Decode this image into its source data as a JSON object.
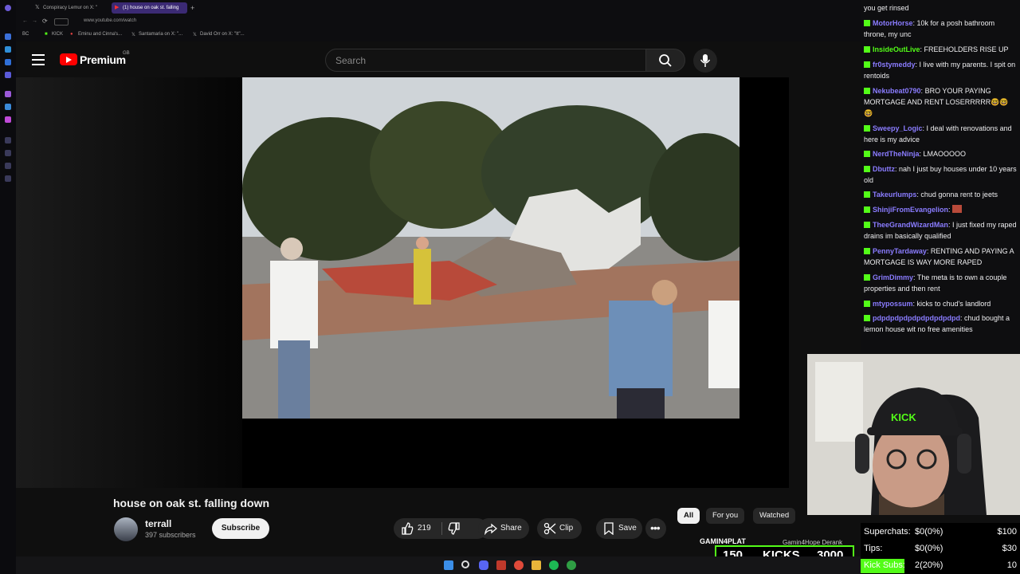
{
  "browser": {
    "tabs": [
      {
        "label": "Conspiracy Lemur on X: \"",
        "icon": "x-logo"
      },
      {
        "label": "(1) house on oak st. falling",
        "icon": "youtube-logo"
      }
    ],
    "new_tab": "+",
    "url": "www.youtube.com/watch",
    "bookmarks": [
      "BC",
      "KICK",
      "Eminu and Cinna's...",
      "Santamaria on X: \"...",
      "David Orr on X: \"It\"..."
    ]
  },
  "youtube": {
    "logo_text": "Premium",
    "region": "GB",
    "search": {
      "placeholder": "Search",
      "value": ""
    },
    "video": {
      "title": "house on oak st. falling down",
      "channel": "terrall",
      "subscribers": "397 subscribers",
      "subscribe_label": "Subscribe",
      "likes": "219",
      "share_label": "Share",
      "clip_label": "Clip",
      "save_label": "Save"
    },
    "chips": [
      "All",
      "For you",
      "Watched"
    ],
    "chips_active": "All"
  },
  "chat": {
    "top_fragment": "you get rinsed",
    "messages": [
      {
        "user": "MotorHorse",
        "text": "10k for a posh bathroom throne, my unc",
        "color": "#8a7cff"
      },
      {
        "user": "InsideOutLive",
        "text": "FREEHOLDERS RISE UP",
        "color": "#53fc18"
      },
      {
        "user": "fr0stymeddy",
        "text": "I live with my parents. I spit on rentoids",
        "color": "#8a7cff"
      },
      {
        "user": "Nekubeat0790",
        "text": "BRO YOUR PAYING MORTGAGE AND RENT LOSERRRRR🤓🤓🤓",
        "color": "#8a7cff"
      },
      {
        "user": "Sweepy_Logic",
        "text": "I deal with renovations and here is my advice",
        "color": "#8a7cff"
      },
      {
        "user": "NerdTheNinja",
        "text": "LMAOOOOO",
        "color": "#8a7cff"
      },
      {
        "user": "Dbuttz",
        "text": "nah I just buy houses under 10 years old",
        "color": "#8a7cff"
      },
      {
        "user": "Takeurlumps",
        "text": "chud gonna rent to jeets",
        "color": "#8a7cff"
      },
      {
        "user": "ShinjiFromEvangelion",
        "text": "",
        "color": "#8a7cff"
      },
      {
        "user": "TheeGrandWizardMan",
        "text": "I just fixed my raped drains im basically qualified",
        "color": "#8a7cff"
      },
      {
        "user": "PennyTardaway",
        "text": "RENTING AND PAYING A MORTGAGE IS WAY MORE RAPED",
        "color": "#8a7cff"
      },
      {
        "user": "GrimDimmy",
        "text": "The meta is to own a couple properties and then rent",
        "color": "#8a7cff"
      },
      {
        "user": "mtypossum",
        "text": "kicks to chud's landlord",
        "color": "#8a7cff"
      },
      {
        "user": "pdpdpdpdpdpdpdpdpdpd",
        "text": "chud bought a lemon house wit no free amenities",
        "color": "#8a7cff"
      }
    ]
  },
  "overlay": {
    "kicks": {
      "current": "150",
      "label": "KICKS",
      "goal": "3000"
    },
    "kicks_user": "GAMIN4PLAT",
    "kicks_user2": "Gamin4Hope Derank",
    "webcam_cap_text": "KICK",
    "stats": [
      {
        "label": "Superchats:",
        "value": "$0(0%)",
        "goal": "$100"
      },
      {
        "label": "Tips:",
        "value": "$0(0%)",
        "goal": "$30"
      },
      {
        "label": "Kick Subs:",
        "value": "2(20%)",
        "goal": "10"
      }
    ]
  },
  "colors": {
    "kick_green": "#53fc18",
    "youtube_red": "#ff0000",
    "tab_active": "#3b2a74"
  }
}
